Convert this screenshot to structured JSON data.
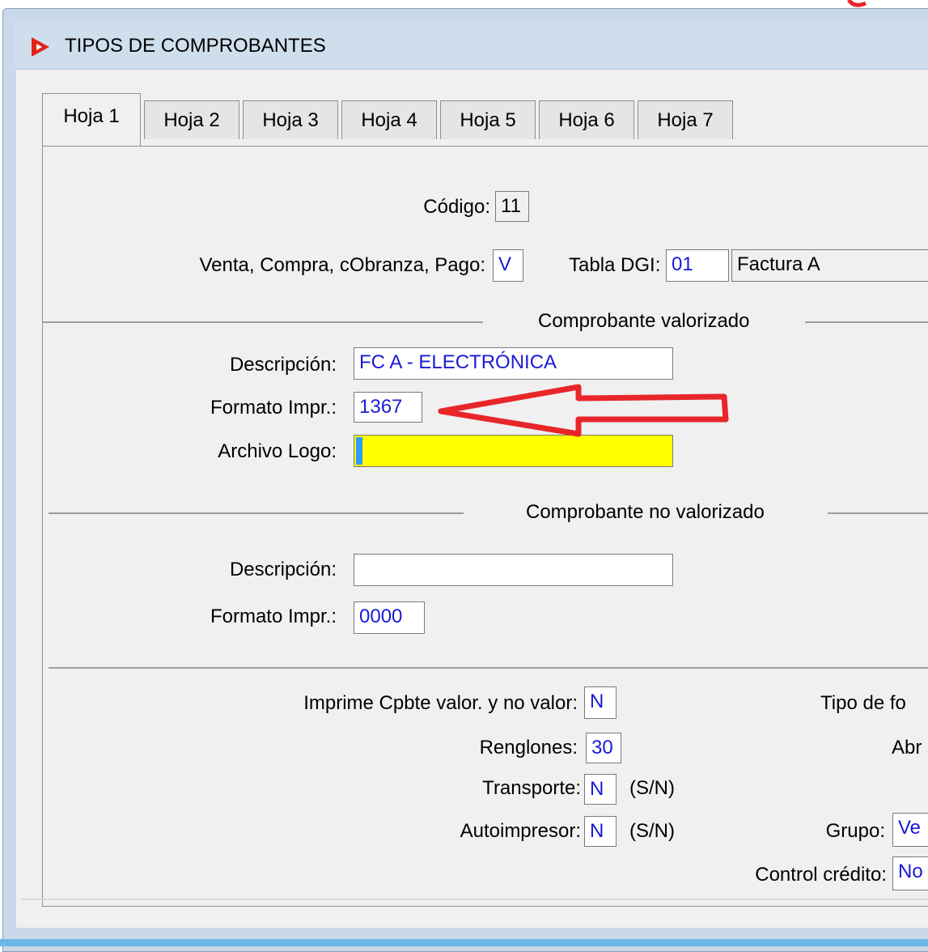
{
  "window": {
    "title": "TIPOS DE COMPROBANTES",
    "icon": "app-logo-icon"
  },
  "tabs": [
    "Hoja 1",
    "Hoja 2",
    "Hoja 3",
    "Hoja 4",
    "Hoja 5",
    "Hoja 6",
    "Hoja 7"
  ],
  "active_tab": "Hoja 1",
  "header": {
    "codigo_label": "Código:",
    "codigo_value": "11",
    "tipo_label": "Venta, Compra, cObranza, Pago:",
    "tipo_value": "V",
    "tabla_dgi_label": "Tabla DGI:",
    "tabla_dgi_code": "01",
    "tabla_dgi_desc": "Factura A"
  },
  "valorizado": {
    "section_title": "Comprobante valorizado",
    "descripcion_label": "Descripción:",
    "descripcion_value": "FC A - ELECTRÓNICA",
    "formato_label": "Formato Impr.:",
    "formato_value": "1367",
    "logo_label": "Archivo Logo:",
    "logo_value": ""
  },
  "no_valorizado": {
    "section_title": "Comprobante no valorizado",
    "descripcion_label": "Descripción:",
    "descripcion_value": "",
    "formato_label": "Formato Impr.:",
    "formato_value": "0000"
  },
  "options": {
    "imprime_label": "Imprime Cpbte valor. y no valor:",
    "imprime_value": "N",
    "renglones_label": "Renglones:",
    "renglones_value": "30",
    "transporte_label": "Transporte:",
    "transporte_value": "N",
    "transporte_hint": "(S/N)",
    "autoimpresor_label": "Autoimpresor:",
    "autoimpresor_value": "N",
    "autoimpresor_hint": "(S/N)",
    "tipo_form_label": "Tipo de fo",
    "abr_label": "Abr",
    "grupo_label": "Grupo:",
    "grupo_value": "Ve",
    "control_label": "Control crédito:",
    "control_value": "No"
  },
  "annotation": {
    "arrow_color": "#e8262a"
  },
  "colors": {
    "input_text": "#1a1ad6",
    "highlight_field": "#ffff00"
  }
}
